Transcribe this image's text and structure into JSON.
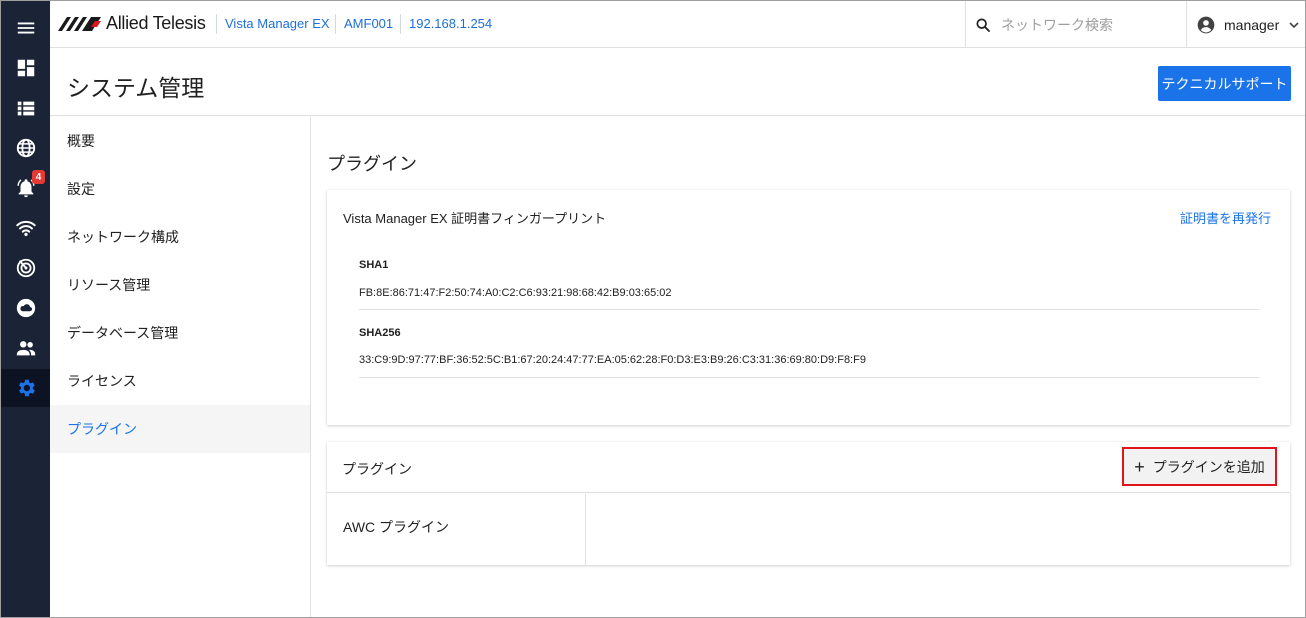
{
  "rail": {
    "items": [
      {
        "icon": "menu-icon"
      },
      {
        "icon": "dashboard-icon"
      },
      {
        "icon": "list-icon"
      },
      {
        "icon": "globe-icon"
      },
      {
        "icon": "bell-icon",
        "badge": "4"
      },
      {
        "icon": "wifi-icon"
      },
      {
        "icon": "radar-icon"
      },
      {
        "icon": "cloud-icon"
      },
      {
        "icon": "users-icon"
      },
      {
        "icon": "gear-icon",
        "active": true
      }
    ],
    "colors": {
      "background": "#1b2436",
      "icon": "#ffffff",
      "active_icon": "#1a73e8"
    }
  },
  "topbar": {
    "logo_text": "Allied Telesis",
    "breadcrumb": [
      "Vista Manager EX",
      "AMF001",
      "192.168.1.254"
    ],
    "search_placeholder": "ネットワーク検索",
    "user_name": "manager"
  },
  "page": {
    "title": "システム管理",
    "support_button": "テクニカルサポート"
  },
  "subnav": {
    "items": [
      "概要",
      "設定",
      "ネットワーク構成",
      "リソース管理",
      "データベース管理",
      "ライセンス",
      "プラグイン"
    ],
    "active_index": 6
  },
  "content": {
    "title": "プラグイン",
    "cert_card": {
      "title": "Vista Manager EX 証明書フィンガープリント",
      "reissue_link": "証明書を再発行",
      "sha1_label": "SHA1",
      "sha1_value": "FB:8E:86:71:47:F2:50:74:A0:C2:C6:93:21:98:68:42:B9:03:65:02",
      "sha256_label": "SHA256",
      "sha256_value": "33:C9:9D:97:77:BF:36:52:5C:B1:67:20:24:47:77:EA:05:62:28:F0:D3:E3:B9:26:C3:31:36:69:80:D9:F8:F9"
    },
    "plugin_card": {
      "title": "プラグイン",
      "add_button": "プラグインを追加",
      "plugins": [
        "AWC プラグイン"
      ]
    }
  },
  "colors": {
    "accent": "#1a73e8",
    "highlight_border": "#e0141b"
  }
}
